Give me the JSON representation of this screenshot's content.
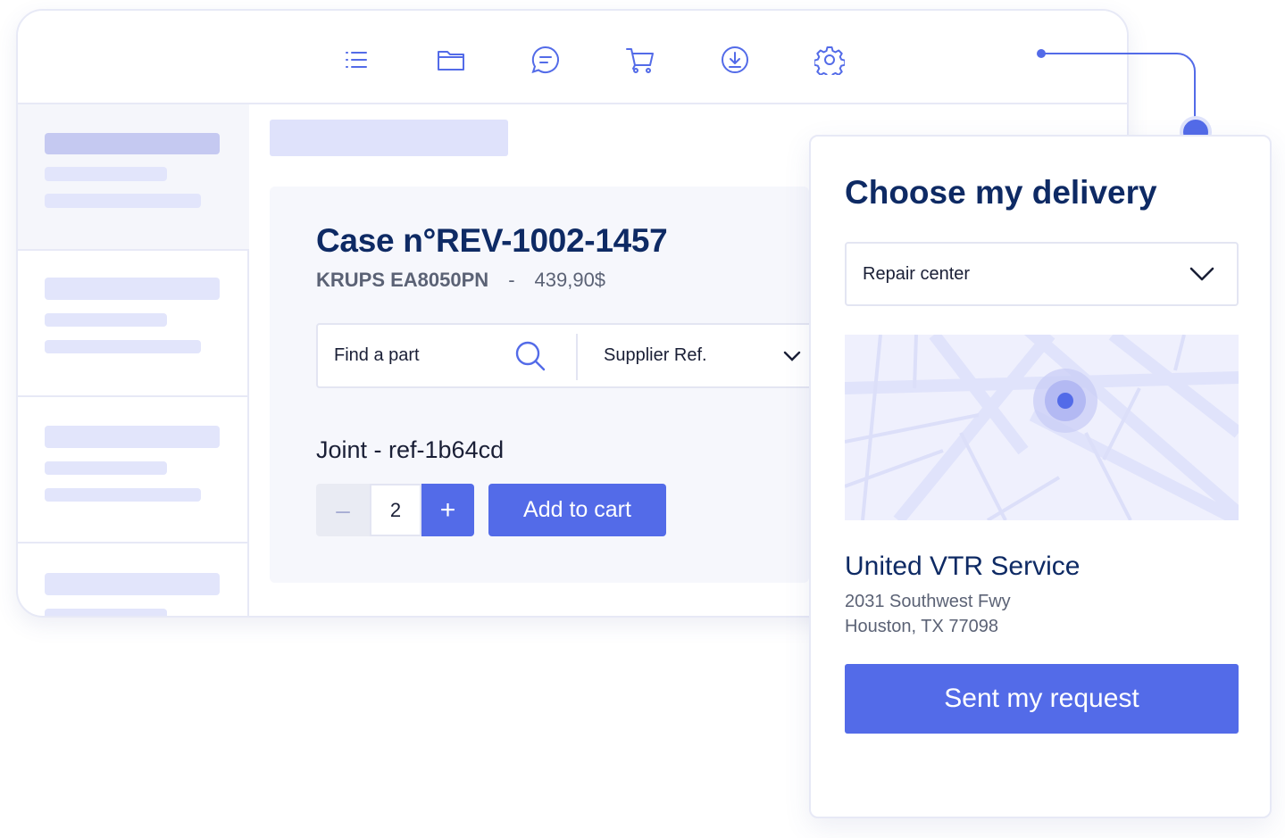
{
  "colors": {
    "accent": "#536be8",
    "heading": "#0e2a64",
    "muted_text": "#5b6275",
    "border": "#e7e9f6",
    "skeleton": "#e2e5fb",
    "skeleton_strong": "#c5c9f1",
    "map_background": "#eff0fd"
  },
  "toolbar": {
    "icons": [
      "list-icon",
      "folder-icon",
      "chat-icon",
      "cart-icon",
      "download-icon",
      "settings-icon"
    ]
  },
  "case": {
    "title": "Case n°REV-1002-1457",
    "model": "KRUPS EA8050PN",
    "separator": "-",
    "price": "439,90$"
  },
  "search": {
    "placeholder": "Find a part",
    "supplier_label": "Supplier Ref."
  },
  "part": {
    "name": "Joint - ref-1b64cd",
    "quantity": "2",
    "minus_label": "–",
    "plus_label": "+",
    "add_to_cart_label": "Add to cart"
  },
  "delivery": {
    "title": "Choose my delivery",
    "selected_option": "Repair center",
    "service_name": "United VTR Service",
    "address_line1": "2031 Southwest Fwy",
    "address_line2": "Houston, TX 77098",
    "submit_label": "Sent my request"
  }
}
